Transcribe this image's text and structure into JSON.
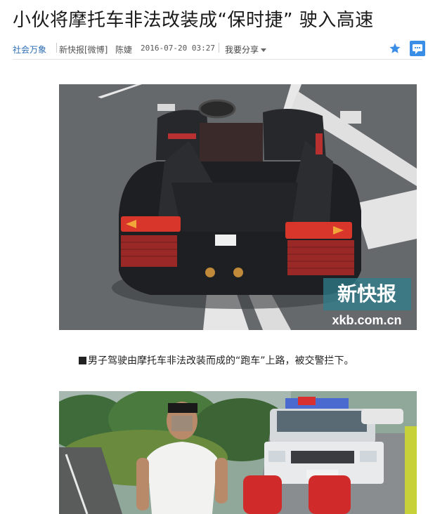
{
  "article": {
    "headline": "小伙将摩托车非法改装成“保时捷” 驶入高速",
    "channel": "社会万象",
    "source": "新快报[微博]",
    "author": "陈婕",
    "timestamp": "2016-07-20 03:27",
    "share_label": "我要分享",
    "caption": "男子驾驶由摩托车非法改装而成的“跑车”上路，被交警拦下。"
  },
  "photo1": {
    "watermark_brand": "新快报",
    "watermark_url": "xkb.com.cn"
  },
  "icons": {
    "favorite": "star-icon",
    "comment": "comment-icon",
    "share_menu": "chevron-down-icon"
  },
  "colors": {
    "link_blue": "#2b6db3",
    "star_blue": "#3a8ee6",
    "watermark_teal": "#2f7f8e"
  }
}
